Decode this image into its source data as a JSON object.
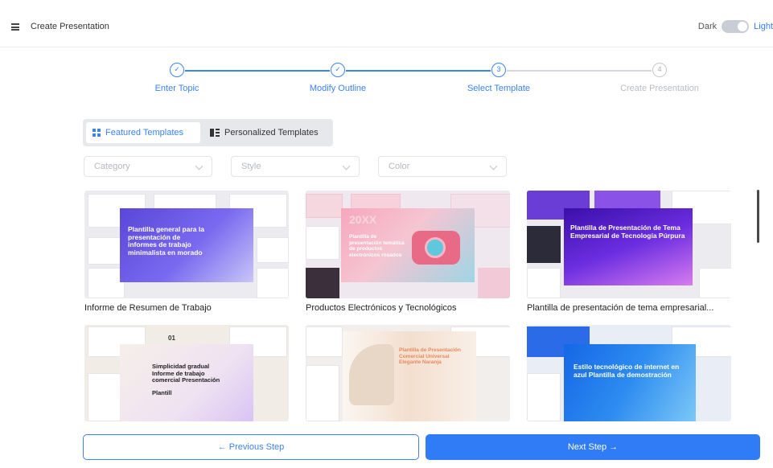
{
  "header": {
    "title": "Create Presentation",
    "theme_dark_label": "Dark",
    "theme_light_label": "Light"
  },
  "steps": [
    {
      "label": "Enter Topic",
      "marker": "✓",
      "state": "done"
    },
    {
      "label": "Modify Outline",
      "marker": "✓",
      "state": "done"
    },
    {
      "label": "Select Template",
      "marker": "3",
      "state": "current"
    },
    {
      "label": "Create Presentation",
      "marker": "4",
      "state": "todo"
    }
  ],
  "tabs": {
    "featured": "Featured Templates",
    "personalized": "Personalized Templates",
    "active": "featured"
  },
  "filters": {
    "category": "Category",
    "style": "Style",
    "color": "Color"
  },
  "templates": [
    {
      "title": "Informe de Resumen de Trabajo",
      "thumb_text": "Plantilla general para la presentación de informes de trabajo minimalista en morado"
    },
    {
      "title": "Productos Electrónicos y Tecnológicos",
      "thumb_text": "Plantilla de presentación temática de productos electrónicos rosados",
      "thumb_badge": "20XX"
    },
    {
      "title": "Plantilla de presentación de tema empresarial...",
      "thumb_text": "Plantilla de Presentación de Tema Empresarial de Tecnología Púrpura"
    },
    {
      "title": "",
      "thumb_text": "Simplicidad gradual Informe de trabajo comercial Presentación",
      "thumb_sub": "Plantill",
      "thumb_num": "01"
    },
    {
      "title": "",
      "thumb_text": "Plantilla de Presentación Comercial Universal Elegante Naranja"
    },
    {
      "title": "",
      "thumb_text": "Estilo tecnológico de internet en azul Plantilla de demostración"
    }
  ],
  "buttons": {
    "previous": "← Previous Step",
    "next": "Next Step →"
  },
  "colors": {
    "accent": "#3b82f6",
    "next_button": "#2f7cf6"
  }
}
